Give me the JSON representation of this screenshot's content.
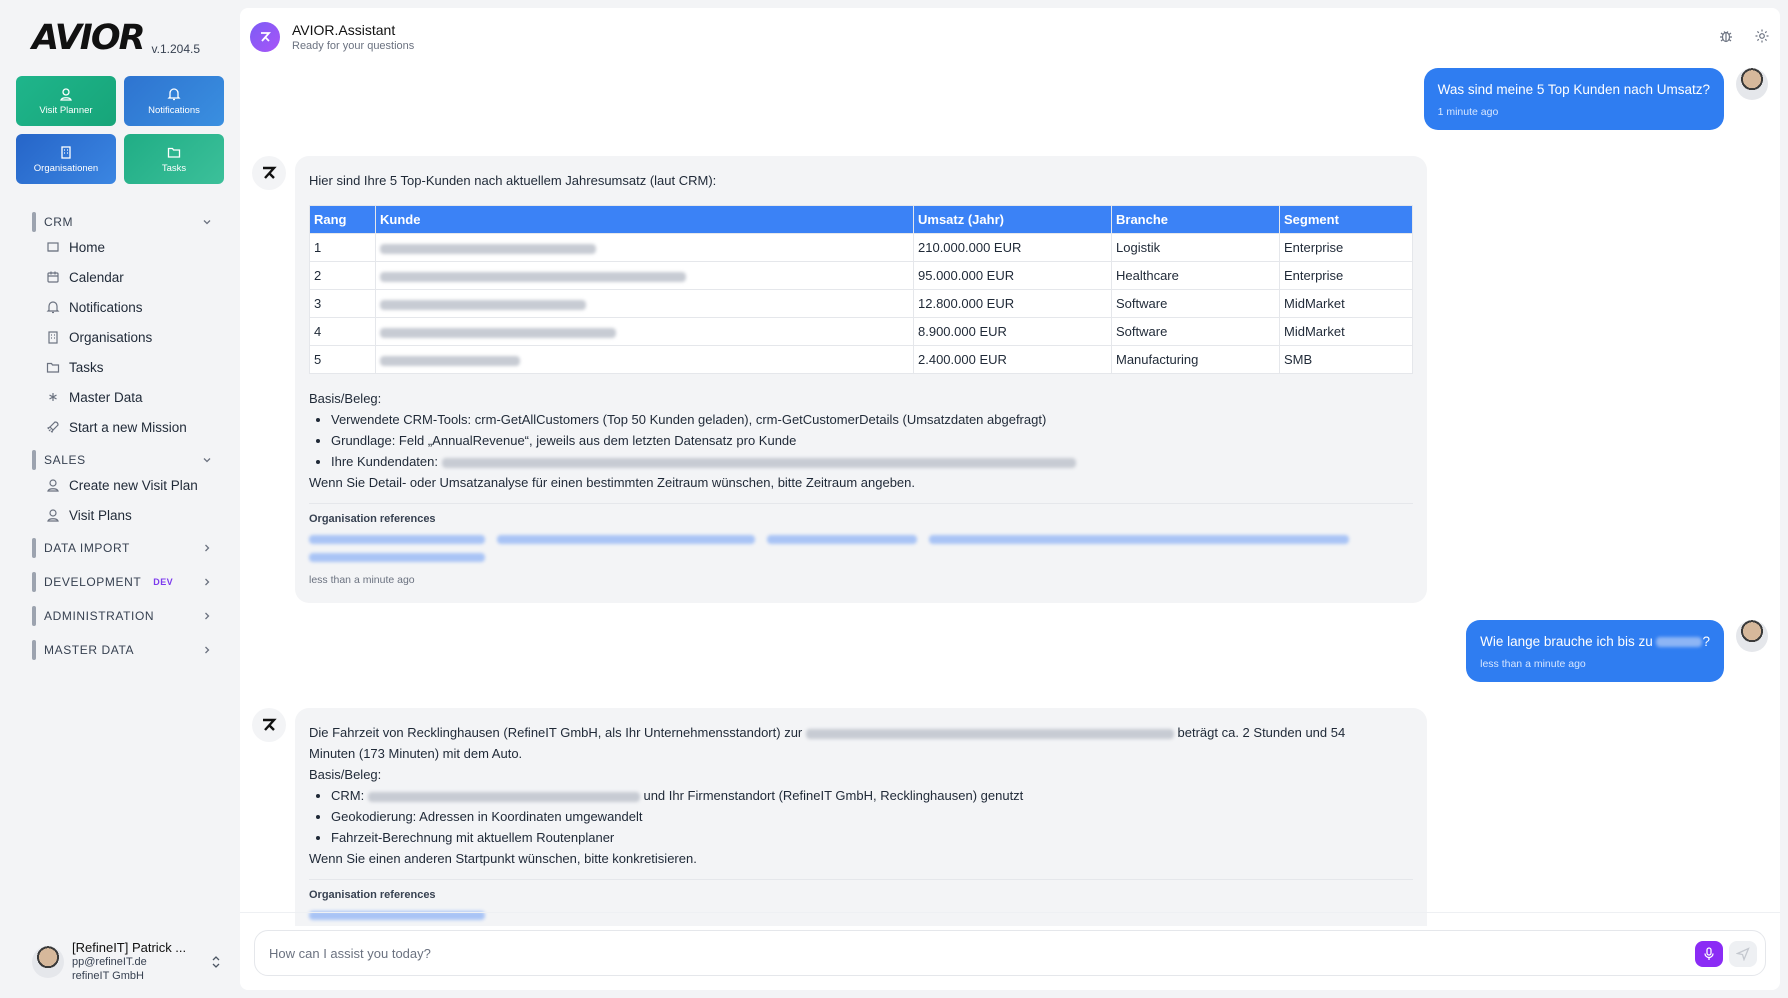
{
  "app": {
    "logo": "AVIOR",
    "version": "v.1.204.5"
  },
  "quick_actions": [
    {
      "label": "Visit Planner",
      "icon": "person-pin-icon",
      "color": "#1fb58b"
    },
    {
      "label": "Notifications",
      "icon": "bell-icon",
      "color": "#2e74d0"
    },
    {
      "label": "Organisationen",
      "icon": "building-icon",
      "color": "#2665c8"
    },
    {
      "label": "Tasks",
      "icon": "folder-icon",
      "color": "#20ad85"
    }
  ],
  "sidebar": {
    "crm": {
      "label": "CRM",
      "items": [
        {
          "label": "Home",
          "icon": "home-icon"
        },
        {
          "label": "Calendar",
          "icon": "calendar-icon"
        },
        {
          "label": "Notifications",
          "icon": "bell-icon"
        },
        {
          "label": "Organisations",
          "icon": "building-icon"
        },
        {
          "label": "Tasks",
          "icon": "folder-icon"
        },
        {
          "label": "Master Data",
          "icon": "asterisk-icon"
        },
        {
          "label": "Start a new Mission",
          "icon": "rocket-icon"
        }
      ]
    },
    "sales": {
      "label": "SALES",
      "items": [
        {
          "label": "Create new Visit Plan",
          "icon": "person-pin-icon"
        },
        {
          "label": "Visit Plans",
          "icon": "person-pin-icon"
        }
      ]
    },
    "data_import": {
      "label": "DATA IMPORT"
    },
    "development": {
      "label": "DEVELOPMENT",
      "badge": "DEV"
    },
    "administration": {
      "label": "ADMINISTRATION"
    },
    "master_data": {
      "label": "MASTER DATA"
    }
  },
  "user": {
    "name": "[RefineIT] Patrick ...",
    "email": "pp@refineIT.de",
    "company": "refineIT GmbH"
  },
  "header": {
    "title": "AVIOR.Assistant",
    "subtitle": "Ready for your questions"
  },
  "messages": {
    "user1": {
      "text": "Was sind meine 5 Top Kunden nach Umsatz?",
      "time": "1 minute ago"
    },
    "bot1": {
      "intro": "Hier sind Ihre 5 Top-Kunden nach aktuellem Jahresumsatz (laut CRM):",
      "columns": [
        "Rang",
        "Kunde",
        "Umsatz (Jahr)",
        "Branche",
        "Segment"
      ],
      "rows": [
        {
          "rank": "1",
          "revenue": "210.000.000 EUR",
          "industry": "Logistik",
          "segment": "Enterprise"
        },
        {
          "rank": "2",
          "revenue": "95.000.000 EUR",
          "industry": "Healthcare",
          "segment": "Enterprise"
        },
        {
          "rank": "3",
          "revenue": "12.800.000 EUR",
          "industry": "Software",
          "segment": "MidMarket"
        },
        {
          "rank": "4",
          "revenue": "8.900.000 EUR",
          "industry": "Software",
          "segment": "MidMarket"
        },
        {
          "rank": "5",
          "revenue": "2.400.000 EUR",
          "industry": "Manufacturing",
          "segment": "SMB"
        }
      ],
      "basis_title": "Basis/Beleg:",
      "bullet1": "Verwendete CRM-Tools: crm-GetAllCustomers (Top 50 Kunden geladen), crm-GetCustomerDetails (Umsatzdaten abgefragt)",
      "bullet2": "Grundlage: Feld „AnnualRevenue“, jeweils aus dem letzten Datensatz pro Kunde",
      "bullet3": "Ihre Kundendaten:",
      "closing": "Wenn Sie Detail- oder Umsatzanalyse für einen bestimmten Zeitraum wünschen, bitte Zeitraum angeben.",
      "refs_title": "Organisation references",
      "time": "less than a minute ago"
    },
    "user2": {
      "text": "Wie lange brauche ich bis zu",
      "suffix": "?",
      "time": "less than a minute ago"
    },
    "bot2": {
      "line1a": "Die Fahrzeit von Recklinghausen (RefineIT GmbH, als Ihr Unternehmensstandort) zur",
      "line1b": "beträgt ca. 2 Stunden und 54",
      "line2": "Minuten (173 Minuten) mit dem Auto.",
      "basis_title": "Basis/Beleg:",
      "bullet1a": "CRM:",
      "bullet1b": "und Ihr Firmenstandort (RefineIT GmbH, Recklinghausen) genutzt",
      "bullet2": "Geokodierung: Adressen in Koordinaten umgewandelt",
      "bullet3": "Fahrzeit-Berechnung mit aktuellem Routenplaner",
      "closing": "Wenn Sie einen anderen Startpunkt wünschen, bitte konkretisieren.",
      "refs_title": "Organisation references"
    }
  },
  "composer": {
    "placeholder": "How can I assist you today?"
  },
  "colors": {
    "accent": "#2f7df1",
    "table_header": "#3b82f6",
    "mic": "#8b2cf5"
  }
}
